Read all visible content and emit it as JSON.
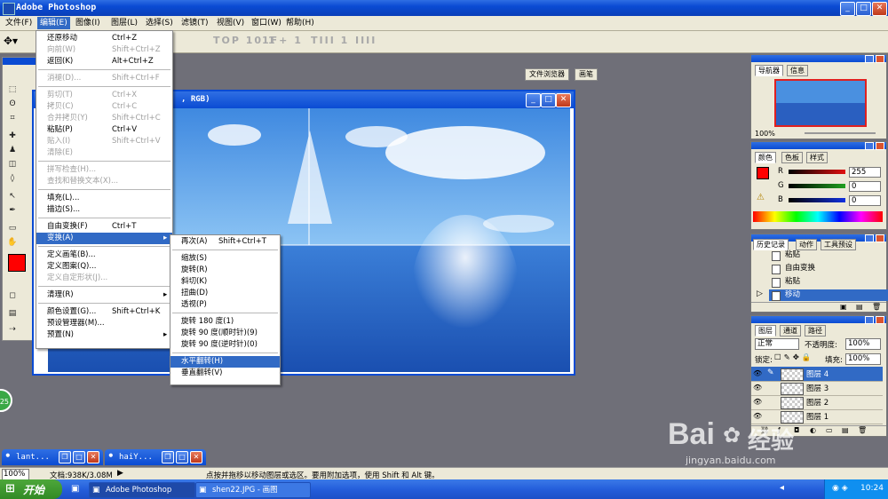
{
  "window": {
    "title": "Adobe Photoshop"
  },
  "menubar": [
    {
      "label": "文件(F)",
      "active": false
    },
    {
      "label": "编辑(E)",
      "active": true
    },
    {
      "label": "图像(I)",
      "active": false
    },
    {
      "label": "图层(L)",
      "active": false
    },
    {
      "label": "选择(S)",
      "active": false
    },
    {
      "label": "滤镜(T)",
      "active": false
    },
    {
      "label": "视图(V)",
      "active": false
    },
    {
      "label": "窗口(W)",
      "active": false
    },
    {
      "label": "帮助(H)",
      "active": false
    }
  ],
  "options_bar": {
    "faded_groups": [
      "TOP 10 1",
      "1F+ 1",
      "TIII 1",
      "IIII"
    ],
    "file_browser_tab": "文件浏览器",
    "brushes_tab": "画笔"
  },
  "document": {
    "title_fragment": ", RGB)"
  },
  "edit_menu": [
    {
      "label": "还原移动",
      "shortcut": "Ctrl+Z",
      "disabled": false
    },
    {
      "label": "向前(W)",
      "shortcut": "Shift+Ctrl+Z",
      "disabled": true
    },
    {
      "label": "返回(K)",
      "shortcut": "Alt+Ctrl+Z",
      "disabled": false
    },
    {
      "sep": true
    },
    {
      "label": "消褪(D)...",
      "shortcut": "Shift+Ctrl+F",
      "disabled": true
    },
    {
      "sep": true
    },
    {
      "label": "剪切(T)",
      "shortcut": "Ctrl+X",
      "disabled": true
    },
    {
      "label": "拷贝(C)",
      "shortcut": "Ctrl+C",
      "disabled": true
    },
    {
      "label": "合并拷贝(Y)",
      "shortcut": "Shift+Ctrl+C",
      "disabled": true
    },
    {
      "label": "粘贴(P)",
      "shortcut": "Ctrl+V",
      "disabled": false
    },
    {
      "label": "贴入(I)",
      "shortcut": "Shift+Ctrl+V",
      "disabled": true
    },
    {
      "label": "清除(E)",
      "shortcut": "",
      "disabled": true
    },
    {
      "sep": true
    },
    {
      "label": "拼写检查(H)...",
      "shortcut": "",
      "disabled": true
    },
    {
      "label": "查找和替换文本(X)...",
      "shortcut": "",
      "disabled": true
    },
    {
      "sep": true
    },
    {
      "label": "填充(L)...",
      "shortcut": "",
      "disabled": false
    },
    {
      "label": "描边(S)...",
      "shortcut": "",
      "disabled": false
    },
    {
      "sep": true
    },
    {
      "label": "自由变换(F)",
      "shortcut": "Ctrl+T",
      "disabled": false
    },
    {
      "label": "变换(A)",
      "shortcut": "",
      "disabled": false,
      "submenu": true,
      "highlighted": true
    },
    {
      "sep": true
    },
    {
      "label": "定义画笔(B)...",
      "shortcut": "",
      "disabled": false
    },
    {
      "label": "定义图案(Q)...",
      "shortcut": "",
      "disabled": false
    },
    {
      "label": "定义自定形状(J)...",
      "shortcut": "",
      "disabled": true
    },
    {
      "sep": true
    },
    {
      "label": "清理(R)",
      "shortcut": "",
      "disabled": false,
      "submenu": true
    },
    {
      "sep": true
    },
    {
      "label": "颜色设置(G)...",
      "shortcut": "Shift+Ctrl+K",
      "disabled": false
    },
    {
      "label": "预设管理器(M)...",
      "shortcut": "",
      "disabled": false
    },
    {
      "label": "预置(N)",
      "shortcut": "",
      "disabled": false,
      "submenu": true
    }
  ],
  "transform_menu": [
    {
      "label": "再次(A)",
      "shortcut": "Shift+Ctrl+T"
    },
    {
      "sep": true
    },
    {
      "label": "缩放(S)"
    },
    {
      "label": "旋转(R)"
    },
    {
      "label": "斜切(K)"
    },
    {
      "label": "扭曲(D)"
    },
    {
      "label": "透视(P)"
    },
    {
      "sep": true
    },
    {
      "label": "旋转 180 度(1)"
    },
    {
      "label": "旋转 90 度(顺时针)(9)"
    },
    {
      "label": "旋转 90 度(逆时针)(0)"
    },
    {
      "sep": true
    },
    {
      "label": "水平翻转(H)",
      "highlighted": true
    },
    {
      "label": "垂直翻转(V)"
    }
  ],
  "navigator": {
    "tabs": [
      "导航器",
      "信息"
    ],
    "zoom": "100%"
  },
  "color_palette": {
    "tabs": [
      "颜色",
      "色板",
      "样式"
    ],
    "channels": [
      {
        "label": "R",
        "value": "255",
        "color": "#e01010"
      },
      {
        "label": "G",
        "value": "0",
        "color": "#20a020"
      },
      {
        "label": "B",
        "value": "0",
        "color": "#1030e0"
      }
    ]
  },
  "history": {
    "tabs": [
      "历史记录",
      "动作",
      "工具预设"
    ],
    "items": [
      {
        "label": "粘贴",
        "selected": false
      },
      {
        "label": "自由变换",
        "selected": false
      },
      {
        "label": "粘贴",
        "selected": false
      },
      {
        "label": "移动",
        "selected": true
      }
    ]
  },
  "layers": {
    "tabs": [
      "图层",
      "通道",
      "路径"
    ],
    "blend_mode": "正常",
    "opacity_label": "不透明度:",
    "opacity": "100%",
    "lock_label": "锁定:",
    "fill_label": "填充:",
    "fill": "100%",
    "items": [
      {
        "name": "图层 4",
        "selected": true
      },
      {
        "name": "图层 3",
        "selected": false
      },
      {
        "name": "图层 2",
        "selected": false
      },
      {
        "name": "图层 1",
        "selected": false
      }
    ]
  },
  "minimized_windows": [
    {
      "title": "lant..."
    },
    {
      "title": "haiY..."
    }
  ],
  "status_bar": {
    "zoom": "100%",
    "doc_size": "文档:938K/3.08M",
    "hint": "点按并拖移以移动图层或选区。要用附加选项，使用 Shift 和 Alt 键。"
  },
  "taskbar": {
    "start": "开始",
    "items": [
      {
        "label": "Adobe Photoshop",
        "active": true
      },
      {
        "label": "shen22.JPG - 画图",
        "active": false
      }
    ],
    "time": "10:24"
  },
  "badge": "25",
  "watermark": {
    "brand": "Bai",
    "brand2": "经验",
    "url": "jingyan.baidu.com"
  },
  "colors": {
    "titlebar": "#0a4bd3",
    "menu_highlight": "#316ac5",
    "foreground": "#ff0000",
    "background": "#000000"
  }
}
